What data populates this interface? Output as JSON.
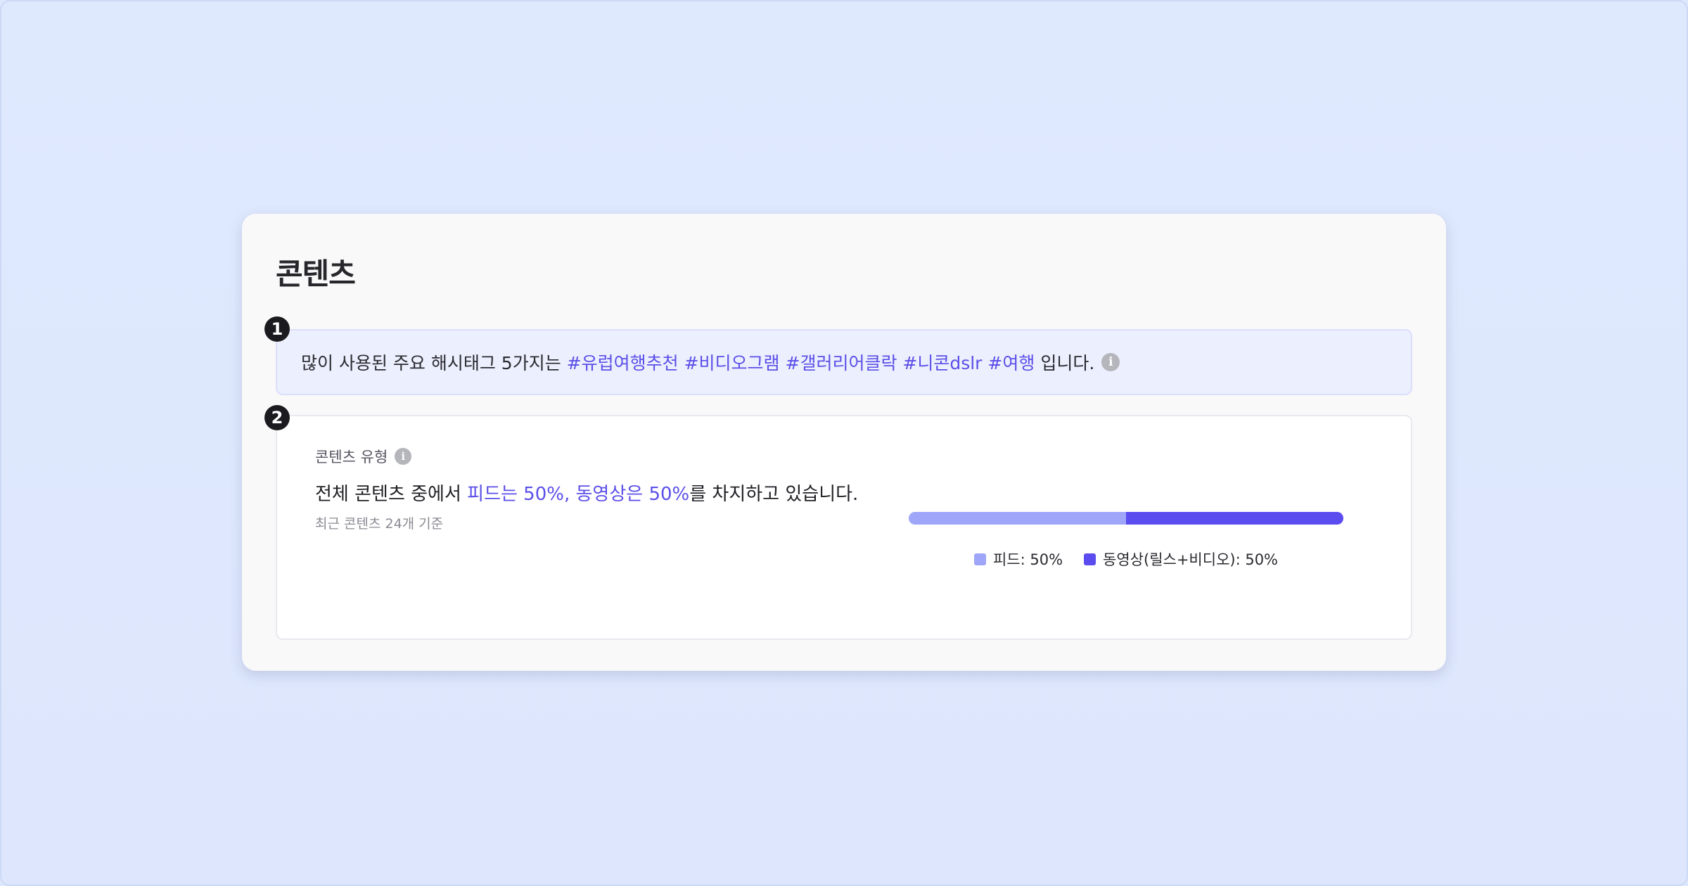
{
  "card": {
    "title": "콘텐츠"
  },
  "markers": [
    "1",
    "2"
  ],
  "hashtags": {
    "prefix": "많이 사용된 주요 해시태그 5가지는",
    "tags": "#유럽여행추천 #비디오그램 #갤러리어클락 #니콘dslr #여행",
    "suffix": "입니다.",
    "info_icon": "info-icon"
  },
  "content_type": {
    "label": "콘텐츠 유형",
    "summary_prefix": "전체 콘텐츠 중에서 ",
    "summary_highlight": "피드는 50%, 동영상은 50%",
    "summary_suffix": "를 차지하고 있습니다.",
    "note": "최근 콘텐츠 24개 기준",
    "legend": {
      "feed": "피드: 50%",
      "video": "동영상(릴스+비디오): 50%"
    },
    "shares": {
      "feed": 50,
      "video": 50
    },
    "colors": {
      "feed": "#9fa6f9",
      "video": "#5b4cf0",
      "highlight": "#5b4fe8"
    }
  }
}
